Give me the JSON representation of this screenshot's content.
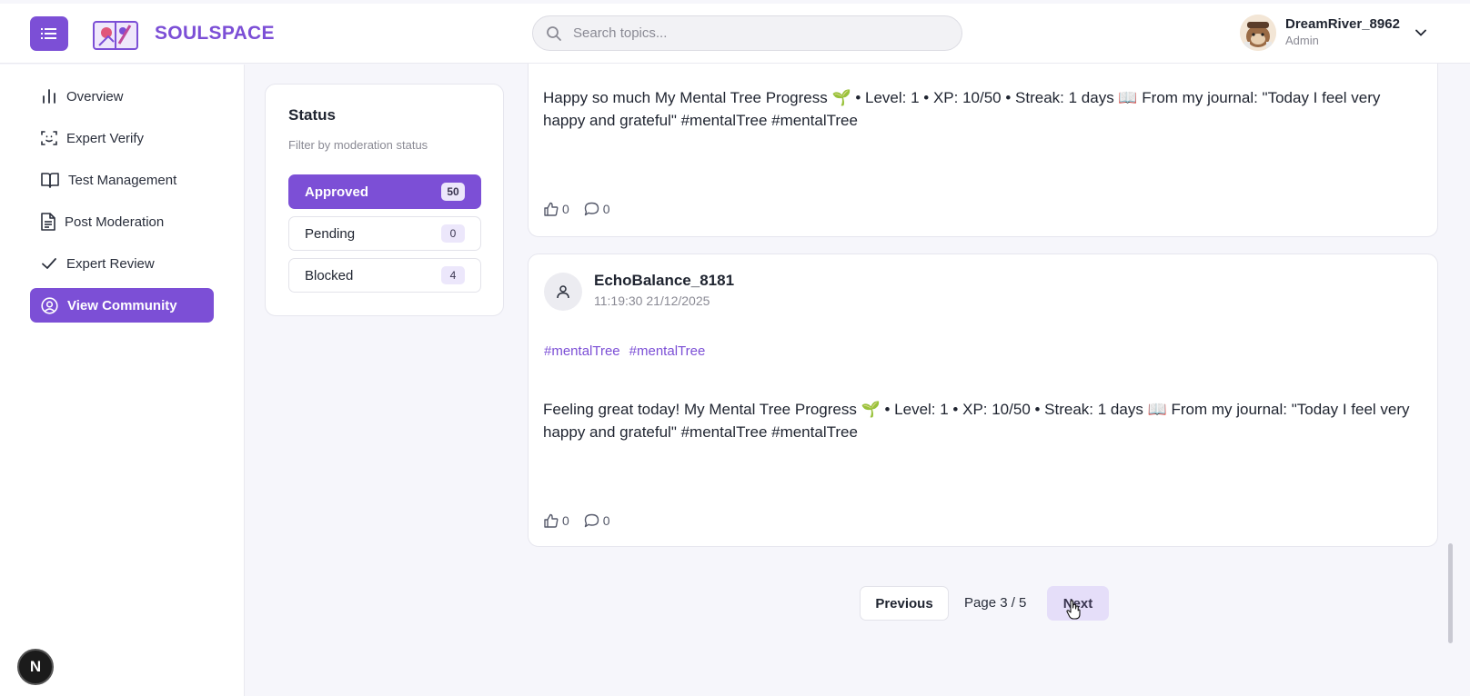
{
  "header": {
    "brand": "SOULSPACE",
    "search_placeholder": "Search topics...",
    "user_name": "DreamRiver_8962",
    "user_role": "Admin"
  },
  "sidebar": {
    "items": [
      {
        "label": "Overview",
        "icon": "bar-chart-icon"
      },
      {
        "label": "Expert Verify",
        "icon": "scan-face-icon"
      },
      {
        "label": "Test Management",
        "icon": "book-open-icon"
      },
      {
        "label": "Post Moderation",
        "icon": "file-text-icon"
      },
      {
        "label": "Expert Review",
        "icon": "check-icon"
      },
      {
        "label": "View Community",
        "icon": "user-circle-icon",
        "active": true
      }
    ],
    "badge_letter": "N"
  },
  "filter": {
    "title": "Status",
    "subtitle": "Filter by moderation status",
    "options": [
      {
        "label": "Approved",
        "count": "50",
        "active": true
      },
      {
        "label": "Pending",
        "count": "0"
      },
      {
        "label": "Blocked",
        "count": "4"
      }
    ]
  },
  "posts": [
    {
      "text": "Happy so much My Mental Tree Progress 🌱 • Level: 1 • XP: 10/50 • Streak: 1 days 📖 From my journal: \"Today I feel very happy and grateful\" #mentalTree #mentalTree",
      "likes": "0",
      "comments": "0"
    },
    {
      "author": "EchoBalance_8181",
      "time": "11:19:30 21/12/2025",
      "tags": [
        "#mentalTree",
        "#mentalTree"
      ],
      "text": "Feeling great today! My Mental Tree Progress 🌱 • Level: 1 • XP: 10/50 • Streak: 1 days 📖 From my journal: \"Today I feel very happy and grateful\" #mentalTree #mentalTree",
      "likes": "0",
      "comments": "0"
    }
  ],
  "pagination": {
    "previous_label": "Previous",
    "page_indicator": "Page 3 / 5",
    "next_label": "Next"
  },
  "colors": {
    "accent": "#7c4fd6",
    "accent_soft": "#e5def9",
    "background": "#f6f6fb"
  }
}
